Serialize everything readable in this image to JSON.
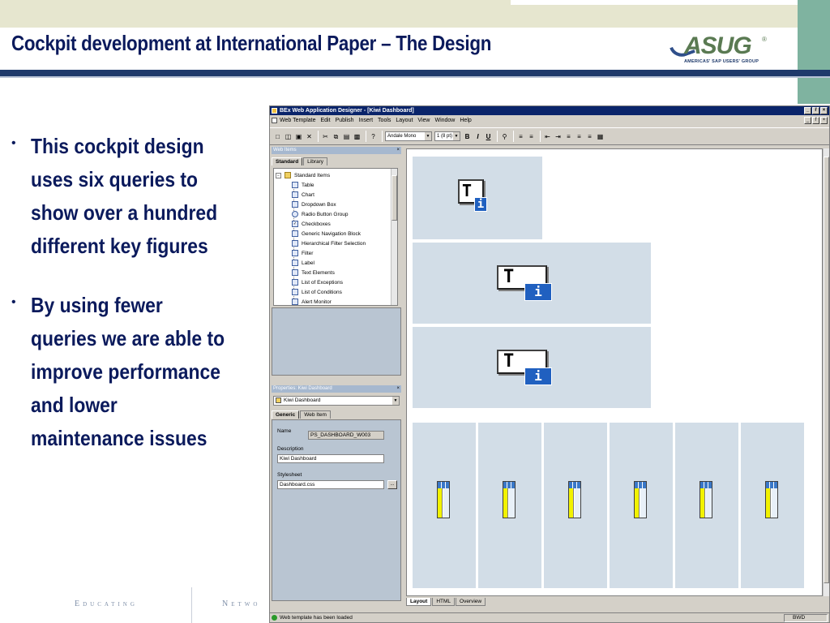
{
  "slide": {
    "title": "Cockpit development at International Paper – The Design",
    "logo_text": "ASUG",
    "logo_reg": "®",
    "logo_subtitle": "AMERICAS' SAP USERS' GROUP",
    "bullets": [
      "This cockpit design uses six queries to show over a hundred different key figures",
      "By using fewer queries we are able to improve performance and lower maintenance issues"
    ],
    "bullet_glyph": "•",
    "footer_words": [
      "Educating",
      "Netwo"
    ]
  },
  "app": {
    "title": "BEx Web Application Designer - [Kiwi Dashboard]",
    "menu": [
      "Web Template",
      "Edit",
      "Publish",
      "Insert",
      "Tools",
      "Layout",
      "View",
      "Window",
      "Help"
    ],
    "window_buttons": [
      "_",
      "ř",
      "×"
    ],
    "toolbar": {
      "font": "Andale Mono",
      "size": "1 (8 pt)",
      "bold": "B",
      "italic": "I",
      "underline": "U"
    },
    "web_items": {
      "header": "Web Items",
      "close": "×",
      "tabs": [
        "Standard",
        "Library"
      ],
      "tree_root": "Standard Items",
      "items": [
        "Table",
        "Chart",
        "Dropdown Box",
        "Radio Button Group",
        "Checkboxes",
        "Generic Navigation Block",
        "Hierarchical Filter Selection",
        "Filter",
        "Label",
        "Text Elements",
        "List of Exceptions",
        "List of Conditions",
        "Alert Monitor"
      ]
    },
    "properties": {
      "header": "Properties: Kiwi Dashboard",
      "close": "×",
      "selected": "Kiwi Dashboard",
      "tabs": [
        "Generic",
        "Web Item"
      ],
      "name_label": "Name",
      "name_value": "PS_DASHBOARD_W003",
      "description_label": "Description",
      "description_value": "Kiwi Dashboard",
      "stylesheet_label": "Stylesheet",
      "stylesheet_value": "Dashboard.css",
      "browse": "..."
    },
    "canvas": {
      "text_icon_letter": "T",
      "info_icon_letter": "i",
      "table_columns": 6
    },
    "bottom_tabs": [
      "Layout",
      "HTML",
      "Overview"
    ],
    "status": "Web template has been loaded",
    "status_mode": "BWD"
  }
}
